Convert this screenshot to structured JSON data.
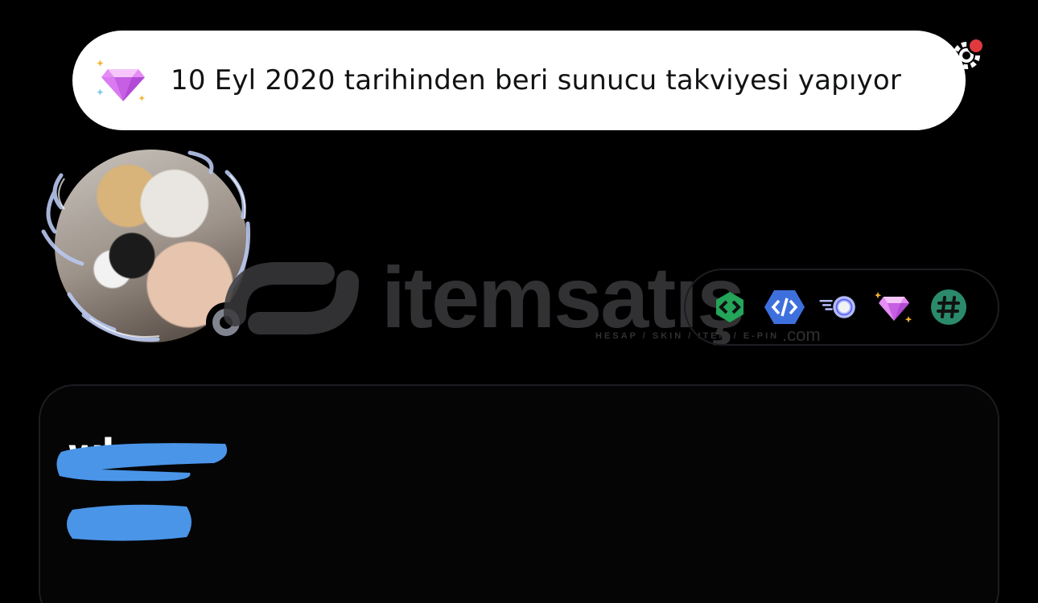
{
  "tooltip": {
    "text": "10 Eyl 2020 tarihinden beri sunucu takviyesi yapıyor",
    "icon": "nitro-boost-gem-icon"
  },
  "settings": {
    "icon": "gear-icon",
    "has_notification": true,
    "notification_color": "#e03a3e"
  },
  "profile": {
    "avatar_icon": "avatar",
    "status": "offline",
    "status_color": "#80848e",
    "username_visible": "wks",
    "username_redacted": true,
    "subtitle_redacted": true
  },
  "badges": [
    {
      "name": "active-developer-badge-icon",
      "color": "#23a55a"
    },
    {
      "name": "early-verified-bot-developer-badge-icon",
      "color": "#3e70dd"
    },
    {
      "name": "nitro-badge-icon",
      "color": "#9aa0ff"
    },
    {
      "name": "server-booster-badge-icon",
      "color": "#ff73fa"
    },
    {
      "name": "hashtag-badge-icon",
      "color": "#2b8a6b"
    }
  ],
  "watermark": {
    "brand": "itemsatış",
    "tagline": "HESAP / SKIN / ITEM / E-PIN",
    "suffix": ".com"
  },
  "colors": {
    "background": "#000000",
    "card_border": "#1c1d21",
    "redaction": "#4a95e8",
    "tooltip_bg": "#ffffff"
  }
}
